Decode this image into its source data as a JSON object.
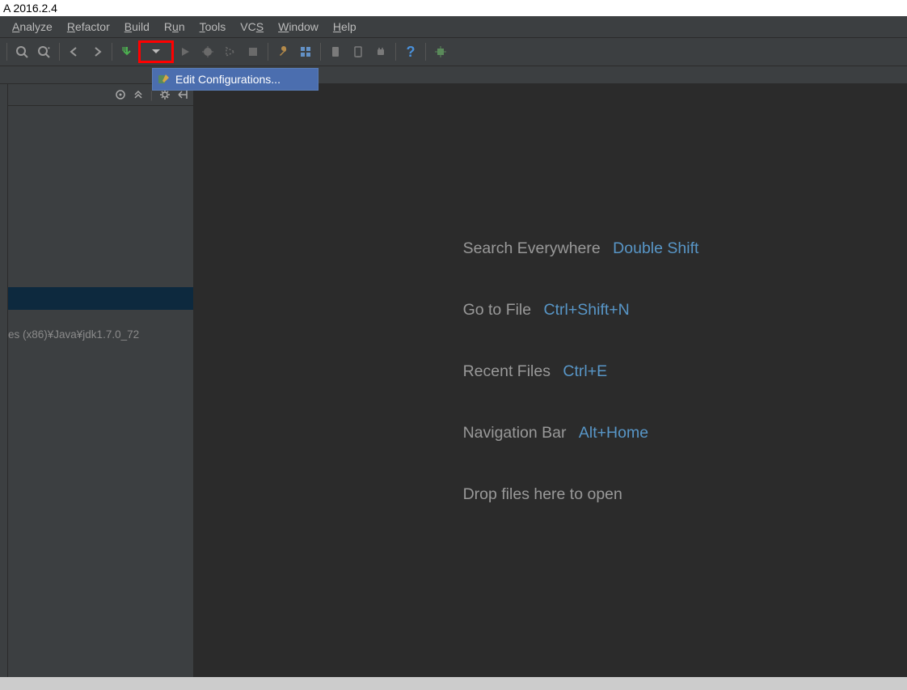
{
  "title": "A 2016.2.4",
  "menu": {
    "analyze": "Analyze",
    "refactor": "Refactor",
    "build": "Build",
    "run": "Run",
    "tools": "Tools",
    "vcs": "VCS",
    "window": "Window",
    "help": "Help"
  },
  "dropdown": {
    "edit_configurations": "Edit Configurations..."
  },
  "tree": {
    "jdk_label": "es (x86)¥Java¥jdk1.7.0_72"
  },
  "welcome": {
    "search": "Search Everywhere",
    "search_key": "Double Shift",
    "goto": "Go to File",
    "goto_key": "Ctrl+Shift+N",
    "recent": "Recent Files",
    "recent_key": "Ctrl+E",
    "nav": "Navigation Bar",
    "nav_key": "Alt+Home",
    "drop": "Drop files here to open"
  }
}
